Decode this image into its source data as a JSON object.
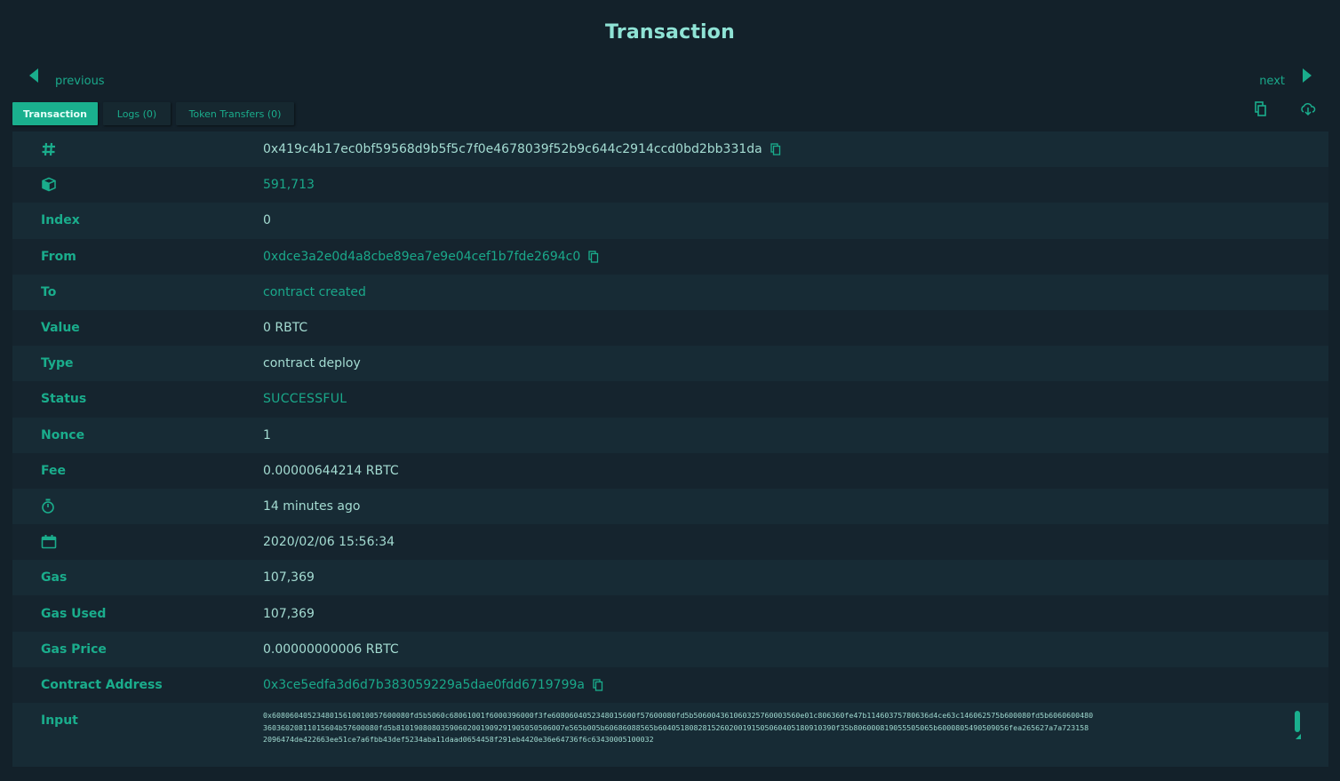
{
  "page": {
    "title": "Transaction"
  },
  "nav": {
    "previous_label": "previous",
    "next_label": "next"
  },
  "tabs": [
    {
      "label": "Transaction",
      "active": true
    },
    {
      "label": "Logs (0)",
      "active": false
    },
    {
      "label": "Token Transfers (0)",
      "active": false
    }
  ],
  "toolbar": {
    "copy_icon": "copy-icon",
    "download_icon": "cloud-download-icon"
  },
  "colors": {
    "accent": "#1ab08e",
    "background": "#13212a",
    "row_odd": "#172b35",
    "row_even": "#15242e",
    "title": "#8fe3d5"
  },
  "fields": {
    "hash": {
      "icon": "hash-icon",
      "value": "0x419c4b17ec0bf59568d9b5f5c7f0e4678039f52b9c644c2914ccd0bd2bb331da"
    },
    "block": {
      "icon": "cube-icon",
      "value": "591,713"
    },
    "index": {
      "label": "Index",
      "value": "0"
    },
    "from": {
      "label": "From",
      "value": "0xdce3a2e0d4a8cbe89ea7e9e04cef1b7fde2694c0"
    },
    "to": {
      "label": "To",
      "value": "contract created"
    },
    "value": {
      "label": "Value",
      "value": "0 RBTC"
    },
    "type": {
      "label": "Type",
      "value": "contract deploy"
    },
    "status": {
      "label": "Status",
      "value": "SUCCESSFUL"
    },
    "nonce": {
      "label": "Nonce",
      "value": "1"
    },
    "fee": {
      "label": "Fee",
      "value": "0.00000644214 RBTC"
    },
    "age": {
      "icon": "stopwatch-icon",
      "value": "14 minutes ago"
    },
    "date": {
      "icon": "calendar-icon",
      "value": "2020/02/06 15:56:34"
    },
    "gas": {
      "label": "Gas",
      "value": "107,369"
    },
    "gas_used": {
      "label": "Gas Used",
      "value": "107,369"
    },
    "gas_price": {
      "label": "Gas Price",
      "value": "0.00000000006 RBTC"
    },
    "contract_address": {
      "label": "Contract Address",
      "value": "0x3ce5edfa3d6d7b383059229a5dae0fdd6719799a"
    },
    "input": {
      "label": "Input",
      "lines": [
        "0x6080604052348015610010057600080fd5b5060c68061001f6000396000f3fe6080604052348015600f57600080fd5b506004361060325760003560e01c806360fe47b11460375780636d4ce63c146062575b600080fd5b6060600480",
        "36036020811015604b57600080fd5b81019080803590602001909291905050506007e565b005b60686088565b6040518082815260200191505060405180910390f35b806000819055505065b6000805490509056fea265627a7a723158",
        "2096474de422663ee51ce7a6fbb43def5234aba11daad0654458f291eb4420e36e64736f6c63430005100032"
      ]
    }
  }
}
